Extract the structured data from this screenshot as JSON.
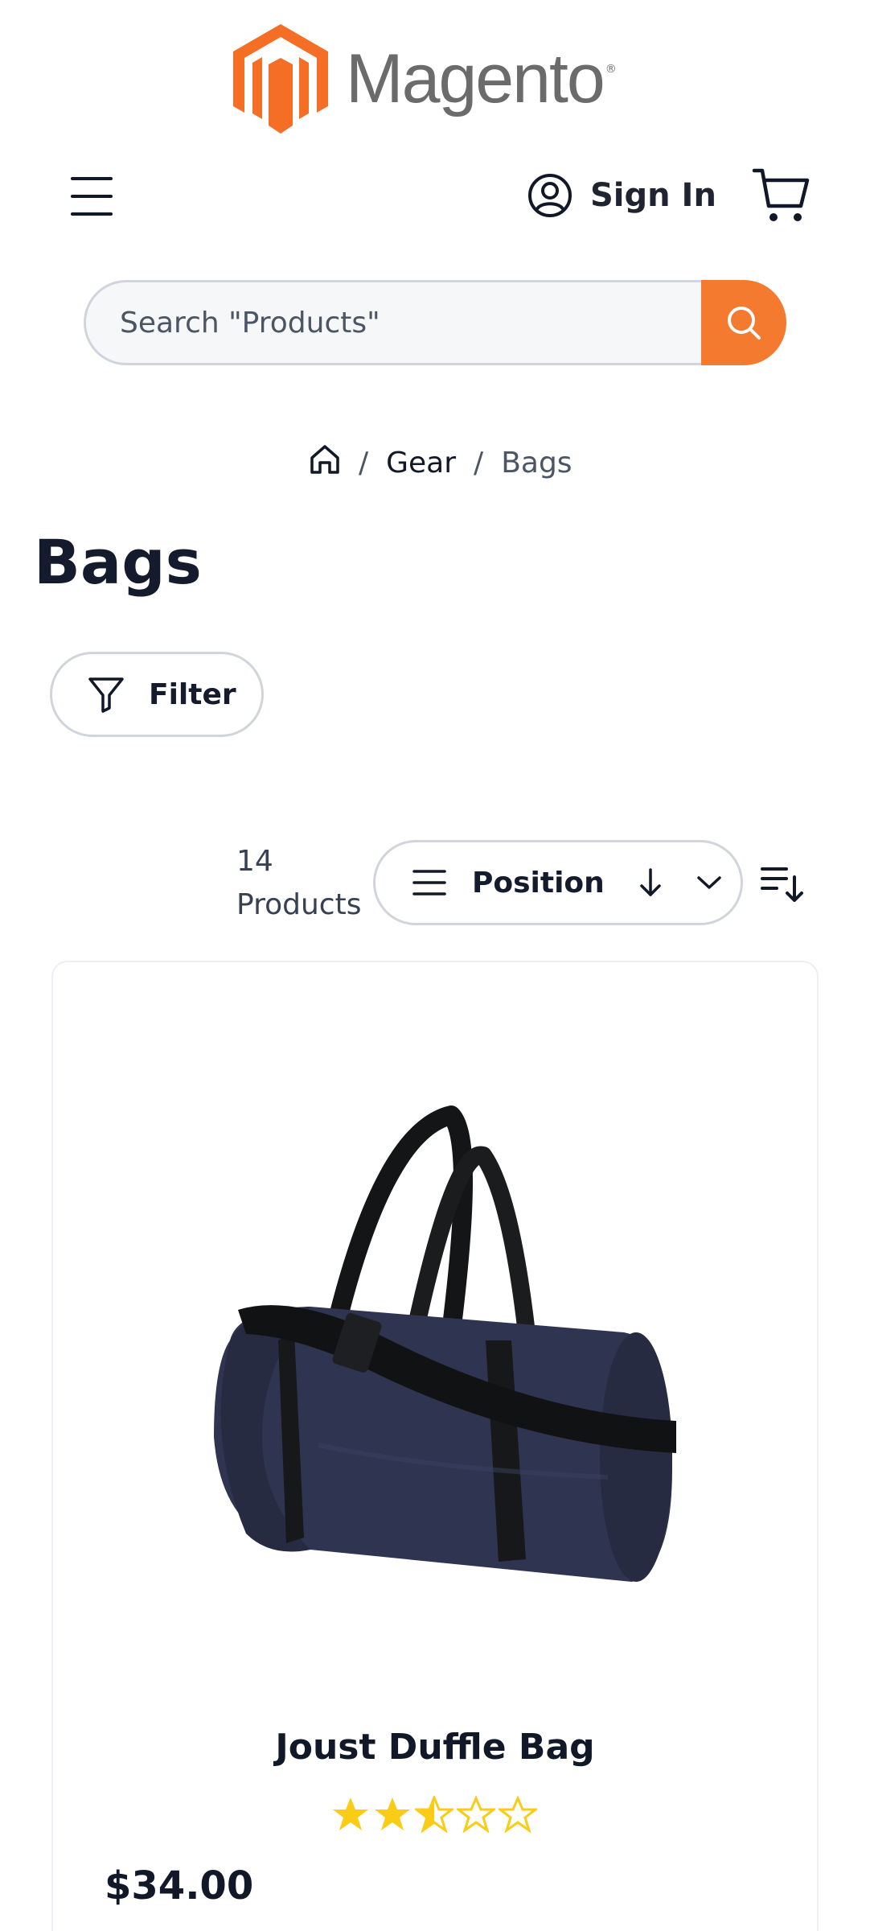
{
  "header": {
    "logo_text": "Magento",
    "logo_registered": "®",
    "brand_color": "#f46f25",
    "signin_label": "Sign In"
  },
  "search": {
    "placeholder": "Search \"Products\""
  },
  "breadcrumb": {
    "separator": "/",
    "items": [
      "Gear",
      "Bags"
    ]
  },
  "page": {
    "title": "Bags"
  },
  "toolbar": {
    "filter_label": "Filter",
    "count_number": "14",
    "count_label": "Products",
    "sort_label": "Position"
  },
  "products": [
    {
      "name": "Joust Duffle Bag",
      "rating": 2.5,
      "rating_max": 5,
      "price": "$34.00"
    }
  ],
  "colors": {
    "accent": "#f47a30",
    "star": "#facc15",
    "text": "#111827"
  }
}
